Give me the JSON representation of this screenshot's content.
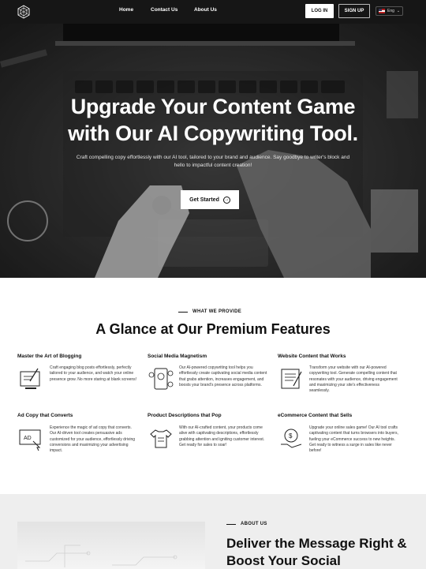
{
  "nav": {
    "links": [
      "Home",
      "Contact Us",
      "About Us"
    ],
    "login_label": "LOG IN",
    "signup_label": "SIGN UP",
    "language": "Eng"
  },
  "hero": {
    "title_line1": "Upgrade Your Content Game",
    "title_line2": "with Our AI Copywriting Tool.",
    "subtitle": "Craft compelling copy effortlessly with our AI tool, tailored to your brand and audience. Say goodbye to writer's block and hello to impactful content creation!",
    "cta_label": "Get Started"
  },
  "features": {
    "eyebrow": "WHAT WE PROVIDE",
    "title": "A Glance at Our Premium Features",
    "items": [
      {
        "title": "Master the Art of Blogging",
        "icon": "blog-writing-icon",
        "text": "Craft engaging blog posts effortlessly, perfectly tailored to your audience, and watch your online presence grow. No more staring at blank screens!"
      },
      {
        "title": "Social Media Magnetism",
        "icon": "social-media-icon",
        "text": "Our AI-powered copywriting tool helps you effortlessly create captivating social media content that grabs attention, increases engagement, and boosts your brand's presence across platforms."
      },
      {
        "title": "Website Content that Works",
        "icon": "website-content-icon",
        "text": "Transform your website with our AI-powered copywriting tool. Generate compelling content that resonates with your audience, driving engagement and maximizing your site's effectiveness seamlessly."
      },
      {
        "title": "Ad Copy that Converts",
        "icon": "ad-copy-icon",
        "text": "Experience the magic of ad copy that converts. Our AI-driven tool creates persuasive ads customized for your audience, effortlessly driving conversions and maximizing your advertising impact."
      },
      {
        "title": "Product Descriptions that Pop",
        "icon": "product-shirt-icon",
        "text": "With our AI-crafted content, your products come alive with captivating descriptions, effortlessly grabbing attention and igniting customer interest. Get ready for sales to soar!"
      },
      {
        "title": "eCommerce Content that Sells",
        "icon": "ecommerce-sales-icon",
        "text": "Upgrade your online sales game! Our AI tool crafts captivating content that turns browsers into buyers, fueling your eCommerce success to new heights. Get ready to witness a surge in sales like never before!"
      }
    ]
  },
  "about": {
    "eyebrow": "ABOUT US",
    "title": "Deliver the Message Right & Boost Your Social"
  },
  "colors": {
    "nav_bg": "#161616",
    "about_bg": "#eeeeee",
    "accent": "#111111"
  }
}
